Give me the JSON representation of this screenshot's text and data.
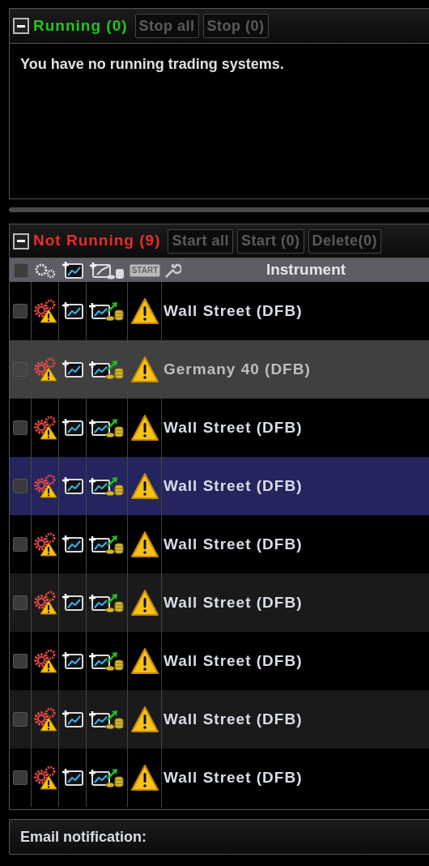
{
  "running": {
    "title": "Running (0)",
    "expanded": true,
    "buttons": [
      "Stop all",
      "Stop (0)"
    ],
    "message": "You have no running trading systems."
  },
  "not_running": {
    "title": "Not Running (9)",
    "expanded": true,
    "buttons": [
      "Start all",
      "Start (0)",
      "Delete(0)"
    ],
    "table": {
      "columns": [
        {
          "kind": "checkbox",
          "checked": false
        },
        {
          "kind": "gears"
        },
        {
          "kind": "chart"
        },
        {
          "kind": "chart-coins"
        },
        {
          "kind": "start",
          "label": "START"
        },
        {
          "kind": "wrench"
        },
        {
          "kind": "text",
          "label": "Instrument"
        }
      ],
      "rows": [
        {
          "instrument": "Wall Street (DFB)",
          "selected": false,
          "disabled": false,
          "checked": false
        },
        {
          "instrument": "Germany 40 (DFB)",
          "selected": false,
          "disabled": true,
          "checked": false
        },
        {
          "instrument": "Wall Street (DFB)",
          "selected": false,
          "disabled": false,
          "checked": false
        },
        {
          "instrument": "Wall Street (DFB)",
          "selected": true,
          "disabled": false,
          "checked": false
        },
        {
          "instrument": "Wall Street (DFB)",
          "selected": false,
          "disabled": false,
          "checked": false
        },
        {
          "instrument": "Wall Street (DFB)",
          "selected": false,
          "disabled": false,
          "checked": false
        },
        {
          "instrument": "Wall Street (DFB)",
          "selected": false,
          "disabled": false,
          "checked": false
        },
        {
          "instrument": "Wall Street (DFB)",
          "selected": false,
          "disabled": false,
          "checked": false
        },
        {
          "instrument": "Wall Street (DFB)",
          "selected": false,
          "disabled": false,
          "checked": false
        }
      ]
    }
  },
  "email": {
    "label": "Email notification:"
  }
}
